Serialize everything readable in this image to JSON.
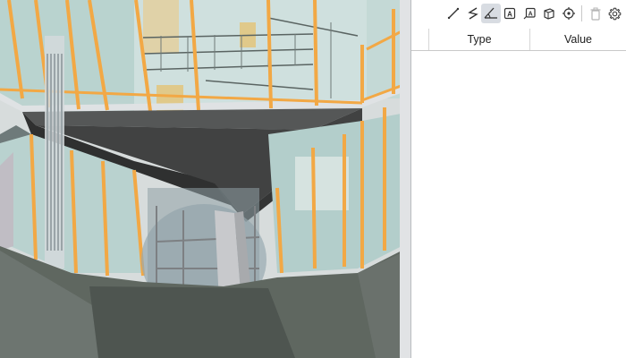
{
  "viewport": {
    "description_icon": "3d-building-viewport",
    "colors": {
      "glass": "#b9d2cf",
      "mullion": "#f2a845",
      "canopy": "#3c3c3c",
      "floor": "#5f6760",
      "column": "#c8c9cc"
    }
  },
  "toolbar": {
    "tools": [
      {
        "name": "line-measure-icon"
      },
      {
        "name": "polyline-measure-icon"
      },
      {
        "name": "angle-measure-icon",
        "active": true
      },
      {
        "name": "text-annotation-icon"
      },
      {
        "name": "leader-annotation-icon"
      },
      {
        "name": "volume-measure-icon"
      },
      {
        "name": "point-locate-icon"
      },
      {
        "name": "delete-icon",
        "disabled": true
      },
      {
        "name": "settings-icon"
      }
    ]
  },
  "properties": {
    "columns": [
      "Type",
      "Value"
    ]
  }
}
